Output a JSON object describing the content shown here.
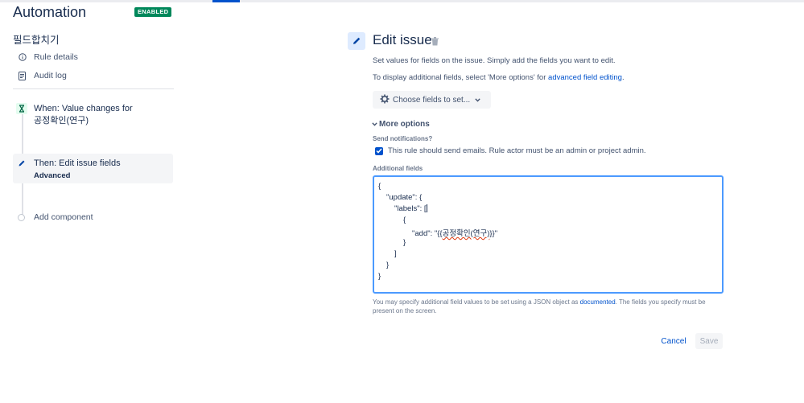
{
  "app": {
    "title": "Automation",
    "status_badge": "ENABLED",
    "rule_name": "필드합치기"
  },
  "nav": {
    "rule_details": "Rule details",
    "audit_log": "Audit log"
  },
  "steps": {
    "trigger": {
      "line1": "When: Value changes for",
      "line2": "공정확인(연구)"
    },
    "action": {
      "line1": "Then: Edit issue fields",
      "line2": "Advanced"
    },
    "add_component": "Add component"
  },
  "editor": {
    "title": "Edit issue",
    "desc1": "Set values for fields on the issue. Simply add the fields you want to edit.",
    "desc2_prefix": "To display additional fields, select 'More options' for ",
    "desc2_link": "advanced field editing",
    "desc2_suffix": ".",
    "choose_fields": "Choose fields to set...",
    "more_options": "More options",
    "send_notifications_label": "Send notifications?",
    "send_notifications_text": "This rule should send emails. Rule actor must be an admin or project admin.",
    "send_notifications_checked": true,
    "additional_fields_label": "Additional fields",
    "json_lines": {
      "l1": "{",
      "l2": "\"update\": {",
      "l3": "\"labels\": [",
      "l4": "{",
      "l5_prefix": "\"add\": \"{{",
      "l5_value": "공정확인(연구)",
      "l5_suffix": "}}\"",
      "l6": "}",
      "l7": "]",
      "l8": "}",
      "l9": "}"
    },
    "help_prefix": "You may specify additional field values to be set using a JSON object as ",
    "help_link": "documented",
    "help_suffix": ". The fields you specify must be present on the screen.",
    "cancel": "Cancel",
    "save": "Save"
  },
  "colors": {
    "primary": "#0052cc",
    "enabled_badge": "#00875a",
    "focus_border": "#4c9aff",
    "trigger_marker": "#e3fcef"
  }
}
